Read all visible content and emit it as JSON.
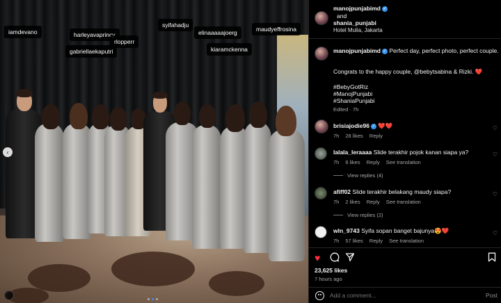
{
  "photo": {
    "tags": [
      {
        "label": "iamdevano"
      },
      {
        "label": "harleyavaprincy"
      },
      {
        "label": "rlopperr"
      },
      {
        "label": "gabriellaekaputri"
      },
      {
        "label": "syifahadju"
      },
      {
        "label": "elinaaaaajoerg"
      },
      {
        "label": "kiaramckenna"
      },
      {
        "label": "maudyeffrosina"
      }
    ],
    "nav_prev_icon": "chevron-left-icon",
    "carousel_dots": 3,
    "carousel_active": 1
  },
  "header": {
    "line1": "manojpunjabimd",
    "line2": "and",
    "line3": "shania_punjabi",
    "location": "Hotel Mulia, Jakarta"
  },
  "caption": {
    "user": "manojpunjabimd",
    "line1": "Perfect day, perfect photo, perfect couple.",
    "line2": "Congrats to the happy couple, @bebytsabina & Rizki.",
    "line2_heart": "❤️",
    "hashtag1": "#BebyGotRiz",
    "hashtag2": "#ManojPunjabi",
    "hashtag3": "#ShaniaPunjabi",
    "meta": "Edited · 7h"
  },
  "comments": [
    {
      "user": "brisiajodie96",
      "text": "❤️❤️",
      "time": "7h",
      "likes": "28 likes",
      "reply": "Reply",
      "translate": ""
    },
    {
      "user": "lalala_leraaaa",
      "text": "Slide terakhir pojok kanan siapa ya?",
      "time": "7h",
      "likes": "6 likes",
      "reply": "Reply",
      "translate": "See translation",
      "view_replies": "View replies (4)"
    },
    {
      "user": "afiff02",
      "text": "Slide terakhir belakang maudy siapa?",
      "time": "7h",
      "likes": "2 likes",
      "reply": "Reply",
      "translate": "See translation",
      "view_replies": "View replies (2)"
    },
    {
      "user": "wln_9743",
      "text": "Syifa sopan banget bajunya😍❤️",
      "time": "7h",
      "likes": "57 likes",
      "reply": "Reply",
      "translate": "See translation"
    }
  ],
  "actions": {
    "likes": "23,625 likes",
    "ago": "7 hours ago"
  },
  "add_comment": {
    "placeholder": "Add a comment...",
    "post": "Post"
  },
  "colors": {
    "background": "#000000",
    "like_red": "#ff3040",
    "verified_blue": "#3897f0",
    "muted": "#a8a8a8"
  }
}
